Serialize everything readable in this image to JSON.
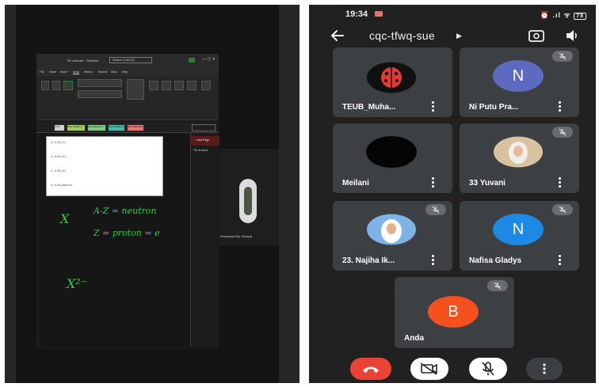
{
  "left_panel": {
    "app_title": "TIK Ardhani - OneNote",
    "search_placeholder": "Search (Ctrl+E)",
    "menu_tabs": [
      "File",
      "Home",
      "Insert",
      "Draw",
      "History",
      "Review",
      "View",
      "Help"
    ],
    "section_tabs": [
      "C1/1",
      "New Section 1",
      "New Section 2",
      "New Section 3",
      "New Section 4"
    ],
    "page_list_header": "+ Add Page",
    "page_list_item": "TIK Ardhani",
    "popup_rows": [
      "2. 6,25 cm",
      "3. 6,25 cm",
      "4. 6,25 cm",
      "5. 6,25 gram/m"
    ],
    "handwriting": {
      "line1": "A-Z = neutron",
      "line2": "Z = proton = e",
      "symbol_1": "X",
      "symbol_2": "X²⁻"
    },
    "presenter_name": "Wulandari Nur Hidayat"
  },
  "phone": {
    "status_time": "19:34",
    "status_right": "⏰ .ıl ᯤ",
    "battery_label": "78",
    "meeting_code": "cqc-tfwq-sue",
    "participants": [
      {
        "name": "TEUB_Muha...",
        "avatar": "ladybug",
        "muted": false,
        "letter": ""
      },
      {
        "name": "Ni Putu Pra...",
        "avatar": "letter",
        "muted": true,
        "letter": "N",
        "color": "#5c6bc0"
      },
      {
        "name": "Meilani",
        "avatar": "dark",
        "muted": false,
        "letter": ""
      },
      {
        "name": "33 Yuvani",
        "avatar": "photo",
        "muted": true,
        "letter": ""
      },
      {
        "name": "23. Najiha Ik...",
        "avatar": "photo",
        "muted": true,
        "letter": ""
      },
      {
        "name": "Nafisa Gladys",
        "avatar": "letter",
        "muted": true,
        "letter": "N",
        "color": "#1e88e5"
      },
      {
        "name": "Anda",
        "avatar": "letter",
        "muted": true,
        "letter": "B",
        "color": "#f4511e"
      }
    ],
    "controls": [
      "end-call",
      "camera-off",
      "mic-off",
      "more"
    ]
  },
  "colors": {
    "end_call": "#ea4335",
    "tile_bg": "#3c4043",
    "screen_bg": "#212121"
  }
}
